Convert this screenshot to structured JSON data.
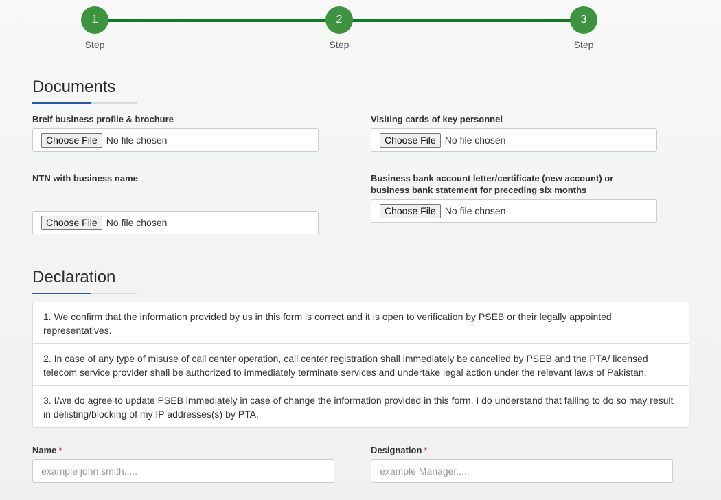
{
  "stepper": {
    "steps": [
      {
        "number": "1",
        "label": "Step"
      },
      {
        "number": "2",
        "label": "Step"
      },
      {
        "number": "3",
        "label": "Step"
      }
    ],
    "accent_color": "#0f7a1f"
  },
  "documents": {
    "title": "Documents",
    "fields": [
      {
        "label": "Breif business profile & brochure",
        "button": "Choose File",
        "status": "No file chosen"
      },
      {
        "label": "Visiting cards of key personnel",
        "button": "Choose File",
        "status": "No file chosen"
      },
      {
        "label": "NTN with business name",
        "button": "Choose File",
        "status": "No file chosen"
      },
      {
        "label": "Business bank account letter/certificate (new account) or business bank statement for preceding six months",
        "button": "Choose File",
        "status": "No file chosen"
      }
    ]
  },
  "declaration": {
    "title": "Declaration",
    "items": [
      "1. We confirm that the information provided by us in this form is correct and it is open to verification by PSEB or their legally appointed representatives.",
      "2. In case of any type of misuse of call center operation, call center registration shall immediately be cancelled by PSEB and the PTA/ licensed telecom service provider shall be authorized to immediately terminate services and undertake legal action under the relevant laws of Pakistan.",
      "3. I/we do agree to update PSEB immediately in case of change the information provided in this form. I do understand that failing to do so may result in delisting/blocking of my IP addresses(s) by PTA."
    ]
  },
  "signatory": {
    "name": {
      "label": "Name",
      "required_mark": "*",
      "placeholder": "example john smith.....",
      "value": ""
    },
    "designation": {
      "label": "Designation",
      "required_mark": "*",
      "placeholder": "example Manager.....",
      "value": ""
    }
  }
}
